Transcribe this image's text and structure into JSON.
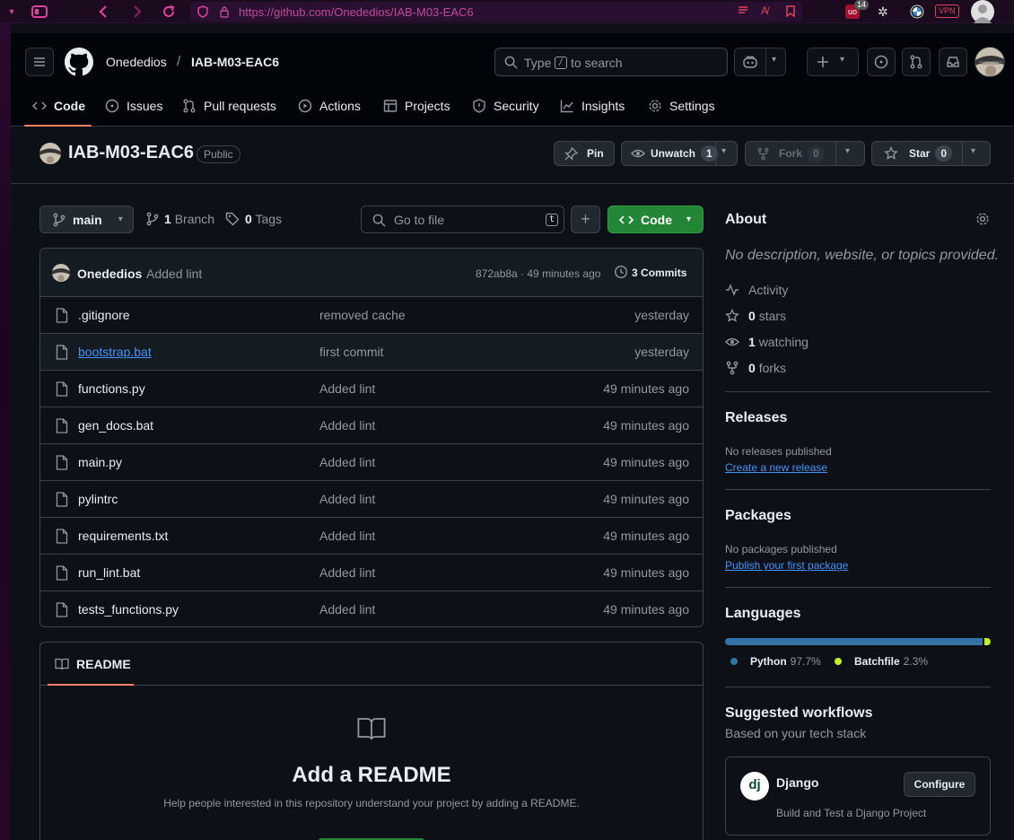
{
  "browser": {
    "url": "https://github.com/Onededios/IAB-M03-EAC6",
    "badge_count": "14",
    "vpn_label": "VPN"
  },
  "header": {
    "owner": "Onededios",
    "separator": "/",
    "repo": "IAB-M03-EAC6",
    "search_prefix": "Type",
    "search_key": "/",
    "search_suffix": "to search"
  },
  "tabs": [
    {
      "label": "Code",
      "icon": "code-icon"
    },
    {
      "label": "Issues",
      "icon": "issue-icon"
    },
    {
      "label": "Pull requests",
      "icon": "pull-request-icon"
    },
    {
      "label": "Actions",
      "icon": "play-icon"
    },
    {
      "label": "Projects",
      "icon": "table-icon"
    },
    {
      "label": "Security",
      "icon": "shield-icon"
    },
    {
      "label": "Insights",
      "icon": "graph-icon"
    },
    {
      "label": "Settings",
      "icon": "gear-icon"
    }
  ],
  "repo_header": {
    "title": "IAB-M03-EAC6",
    "visibility": "Public",
    "pin_label": "Pin",
    "unwatch_label": "Unwatch",
    "watch_count": "1",
    "fork_label": "Fork",
    "fork_count": "0",
    "star_label": "Star",
    "star_count": "0"
  },
  "toolbar": {
    "branch": "main",
    "branch_count": "1",
    "branch_label": "Branch",
    "tag_count": "0",
    "tag_label": "Tags",
    "goto_placeholder": "Go to file",
    "goto_key": "t",
    "plus": "+",
    "code_label": "Code"
  },
  "commit": {
    "author": "Onededios",
    "message": "Added lint",
    "hash_time": "872ab8a · 49 minutes ago",
    "commits_count": "3",
    "commits_label": "Commits"
  },
  "files": [
    {
      "name": ".gitignore",
      "message": "removed cache",
      "date": "yesterday"
    },
    {
      "name": "bootstrap.bat",
      "message": "first commit",
      "date": "yesterday"
    },
    {
      "name": "functions.py",
      "message": "Added lint",
      "date": "49 minutes ago"
    },
    {
      "name": "gen_docs.bat",
      "message": "Added lint",
      "date": "49 minutes ago"
    },
    {
      "name": "main.py",
      "message": "Added lint",
      "date": "49 minutes ago"
    },
    {
      "name": "pylintrc",
      "message": "Added lint",
      "date": "49 minutes ago"
    },
    {
      "name": "requirements.txt",
      "message": "Added lint",
      "date": "49 minutes ago"
    },
    {
      "name": "run_lint.bat",
      "message": "Added lint",
      "date": "49 minutes ago"
    },
    {
      "name": "tests_functions.py",
      "message": "Added lint",
      "date": "49 minutes ago"
    }
  ],
  "readme": {
    "tab_label": "README",
    "title": "Add a README",
    "subtitle": "Help people interested in this repository understand your project by adding a README."
  },
  "about": {
    "title": "About",
    "description": "No description, website, or topics provided.",
    "activity_label": "Activity",
    "stars_count": "0",
    "stars_label": "stars",
    "watching_count": "1",
    "watching_label": "watching",
    "forks_count": "0",
    "forks_label": "forks"
  },
  "releases": {
    "title": "Releases",
    "status": "No releases published",
    "link": "Create a new release"
  },
  "packages": {
    "title": "Packages",
    "status": "No packages published",
    "link": "Publish your first package"
  },
  "languages": {
    "title": "Languages",
    "items": [
      {
        "name": "Python",
        "percent": "97.7%",
        "value": 97.7,
        "color": "#3572A5"
      },
      {
        "name": "Batchfile",
        "percent": "2.3%",
        "value": 2.3,
        "color": "#C1F12E"
      }
    ]
  },
  "workflows": {
    "title": "Suggested workflows",
    "subtitle": "Based on your tech stack",
    "card_title": "Django",
    "card_logo": "dj",
    "card_desc": "Build and Test a Django Project",
    "configure_label": "Configure"
  },
  "colors": {
    "accent_green": "#238636",
    "underline_orange": "#f78166",
    "link_blue": "#4493f8"
  }
}
